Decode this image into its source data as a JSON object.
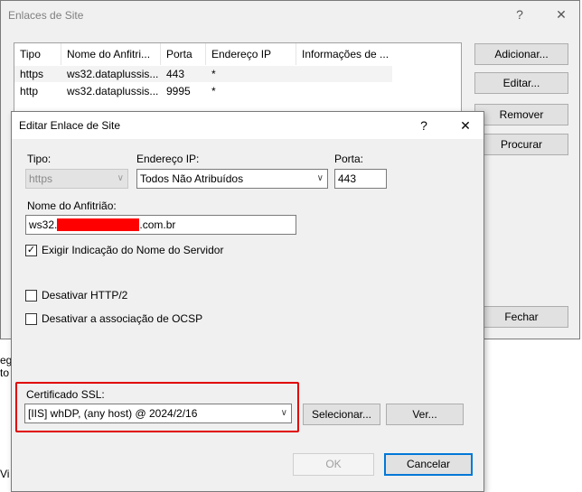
{
  "outer_window": {
    "title": "Enlaces de Site",
    "help_glyph": "?",
    "close_glyph": "✕",
    "columns": [
      "Tipo",
      "Nome do Anfitri...",
      "Porta",
      "Endereço IP",
      "Informações de ..."
    ],
    "rows": [
      {
        "tipo": "https",
        "nome": "ws32.dataplussis...",
        "porta": "443",
        "ip": "*"
      },
      {
        "tipo": "http",
        "nome": "ws32.dataplussis...",
        "porta": "9995",
        "ip": "*"
      }
    ],
    "buttons": {
      "add": "Adicionar...",
      "edit": "Editar...",
      "remove": "Remover",
      "browse": "Procurar",
      "close": "Fechar"
    }
  },
  "background_fragments": {
    "left_1": "eg",
    "left_2": "to",
    "bottom": "Vi"
  },
  "dialog": {
    "title": "Editar Enlace de Site",
    "help_glyph": "?",
    "close_glyph": "✕",
    "type_label": "Tipo:",
    "type_value": "https",
    "ip_label": "Endereço IP:",
    "ip_value": "Todos Não Atribuídos",
    "port_label": "Porta:",
    "port_value": "443",
    "host_label": "Nome do Anfitrião:",
    "host_prefix": "ws32.",
    "host_suffix": ".com.br",
    "sni_label": "Exigir Indicação do Nome do Servidor",
    "sni_checked": true,
    "sni_check_glyph": "✓",
    "http2_label": "Desativar HTTP/2",
    "http2_checked": false,
    "ocsp_label": "Desativar a associação de OCSP",
    "ocsp_checked": false,
    "ssl_label": "Certificado SSL:",
    "ssl_value": "[IIS] whDP, (any host) @ 2024/2/16",
    "select_button": "Selecionar...",
    "view_button": "Ver...",
    "ok_button": "OK",
    "cancel_button": "Cancelar",
    "dropdown_glyph": "∨",
    "highlight_color": "#e00000",
    "redaction_color": "#ff0000"
  }
}
